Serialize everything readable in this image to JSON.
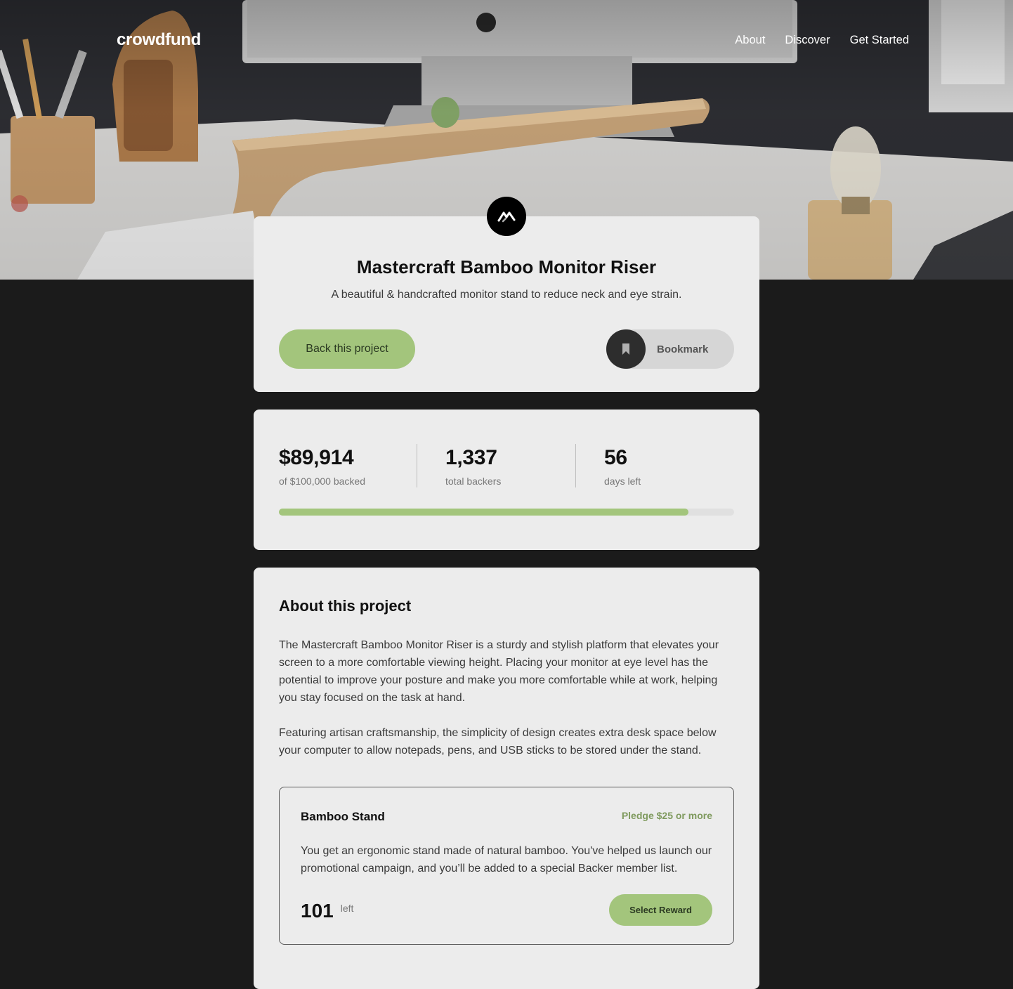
{
  "header": {
    "brand": "crowdfund",
    "nav": [
      "About",
      "Discover",
      "Get Started"
    ]
  },
  "project": {
    "logo_icon": "mastercraft-logo-icon",
    "title": "Mastercraft Bamboo Monitor Riser",
    "subtitle": "A beautiful & handcrafted monitor stand to reduce neck and eye strain.",
    "back_label": "Back this project",
    "bookmark_label": "Bookmark",
    "bookmark_icon": "bookmark-icon"
  },
  "stats": {
    "backed_value": "$89,914",
    "backed_label": "of $100,000 backed",
    "backers_value": "1,337",
    "backers_label": "total backers",
    "days_value": "56",
    "days_label": "days left",
    "progress_fraction": 0.9
  },
  "about": {
    "title": "About this project",
    "p1": "The Mastercraft Bamboo Monitor Riser is a sturdy and stylish platform that elevates your screen to a more comfortable viewing height. Placing your monitor at eye level has the potential to improve your posture and make you more comfortable while at work, helping you stay focused on the task at hand.",
    "p2": "Featuring artisan craftsmanship, the simplicity of design creates extra desk space below your computer to allow notepads, pens, and USB sticks to be stored under the stand."
  },
  "reward": {
    "name": "Bamboo Stand",
    "pledge": "Pledge $25 or more",
    "description": "You get an ergonomic stand made of natural bamboo. You've helped us launch our promotional campaign, and you’ll be added to a special Backer member list.",
    "left_count": "101",
    "left_label": "left",
    "select_label": "Select Reward"
  },
  "colors": {
    "accent": "#a3c57c",
    "accent_text": "#7f9a5e",
    "page_bg": "#1b1b1b",
    "card_bg": "#ececec"
  }
}
